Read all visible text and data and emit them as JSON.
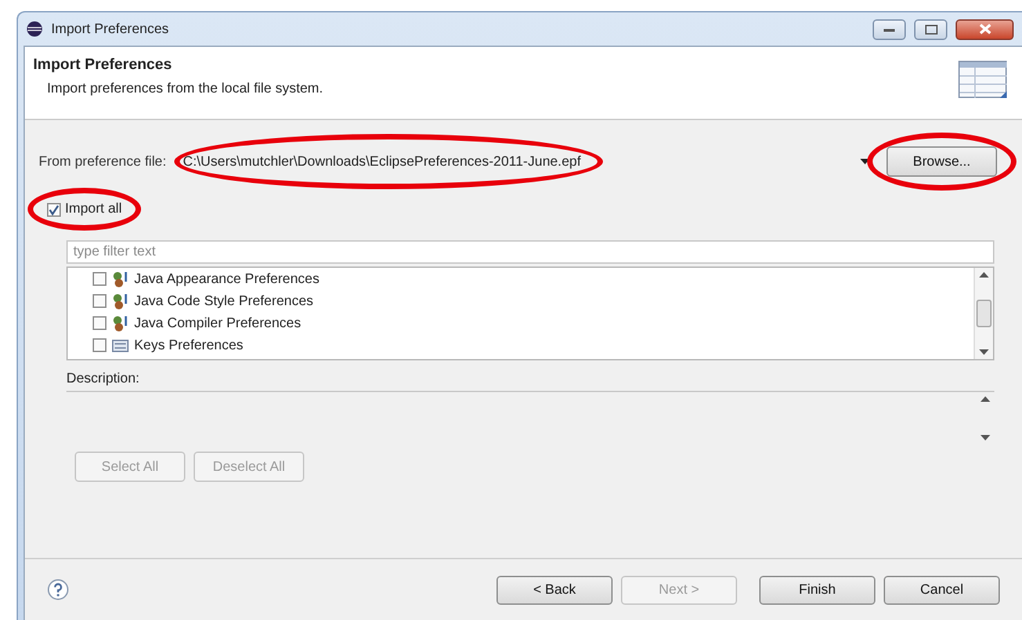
{
  "window": {
    "title": "Import Preferences"
  },
  "header": {
    "title": "Import Preferences",
    "description": "Import preferences from the local file system."
  },
  "file_row": {
    "label": "From preference file:",
    "value": "C:\\Users\\mutchler\\Downloads\\EclipsePreferences-2011-June.epf",
    "circled": true,
    "browse": {
      "label": "Browse...",
      "circled": true
    }
  },
  "import_all": {
    "label": "Import all",
    "checked": true,
    "circled": true
  },
  "filter": {
    "placeholder": "type filter text"
  },
  "tree": [
    {
      "label": "Java Appearance Preferences",
      "checked": false,
      "kind": "java"
    },
    {
      "label": "Java Code Style Preferences",
      "checked": false,
      "kind": "java"
    },
    {
      "label": "Java Compiler Preferences",
      "checked": false,
      "kind": "java"
    },
    {
      "label": "Keys Preferences",
      "checked": false,
      "kind": "keys"
    }
  ],
  "description_label": "Description:",
  "selection_buttons": [
    {
      "label": "Select All",
      "disabled": true
    },
    {
      "label": "Deselect All",
      "disabled": true
    }
  ],
  "footer_buttons": [
    {
      "label": "< Back",
      "disabled": false
    },
    {
      "label": "Next >",
      "disabled": true
    },
    {
      "label": "Finish",
      "disabled": false
    },
    {
      "label": "Cancel",
      "disabled": false
    }
  ]
}
